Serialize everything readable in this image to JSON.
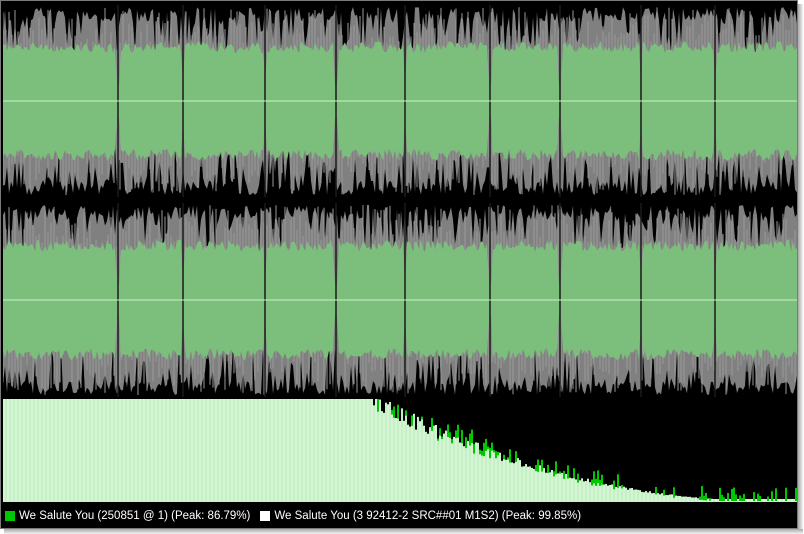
{
  "colors": {
    "background": "#000000",
    "waveform_outer": "#808080",
    "waveform_inner": "#7cbf7c",
    "centerline": "#c8f0c8",
    "spectrum_a": "#00c800",
    "spectrum_b": "#ffffff",
    "spectrum_overlap": "#d4f5d4"
  },
  "legend": [
    {
      "label": "We Salute You (250851 @ 1) (Peak: 86.79%)",
      "color": "#00c800"
    },
    {
      "label": "We Salute You (3 92412-2 SRC##01 M1S2) (Peak: 99.85%)",
      "color": "#ffffff"
    }
  ],
  "waveform": {
    "channels": 2,
    "peak_outer_fraction": 0.96,
    "inner_fraction": 0.55
  }
}
